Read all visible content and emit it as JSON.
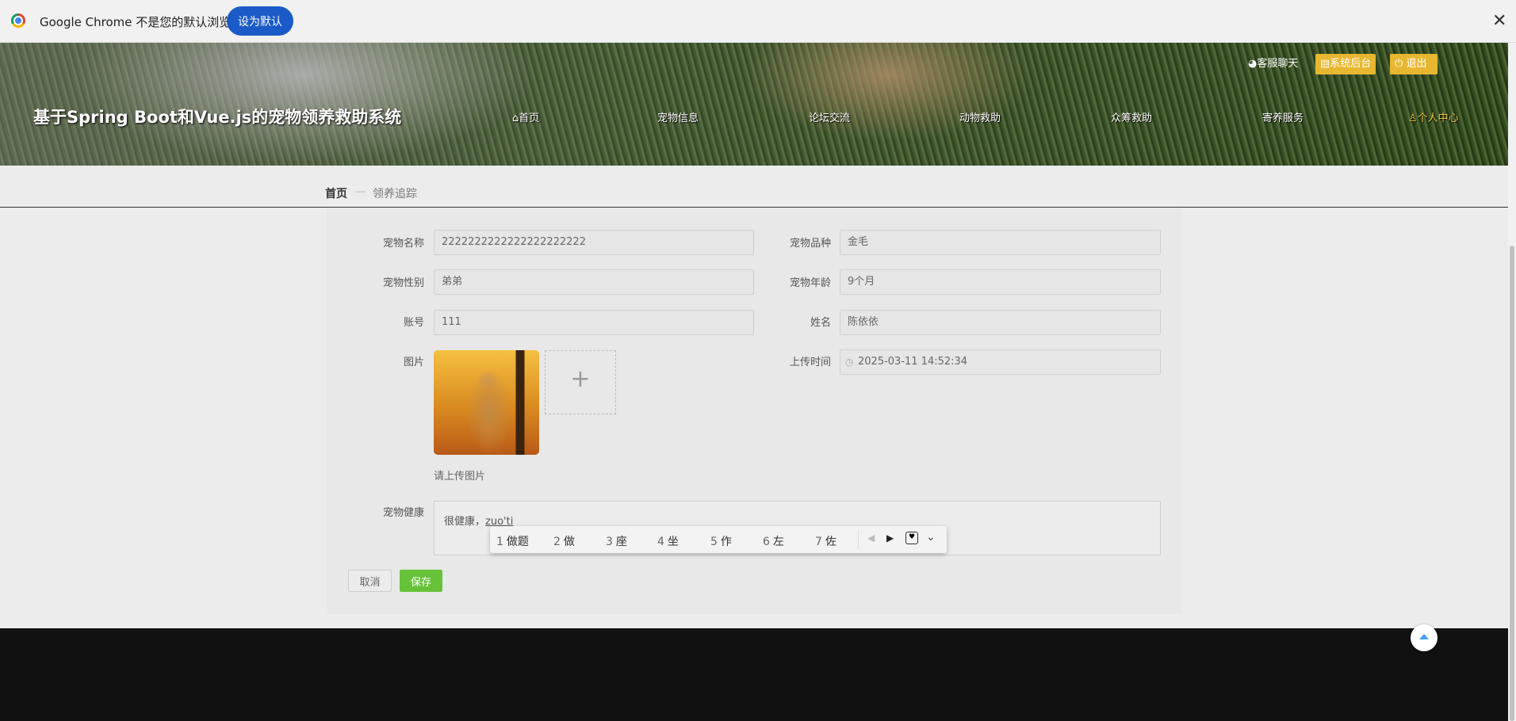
{
  "infobar": {
    "message": "Google Chrome 不是您的默认浏览器",
    "set_default_label": "设为默认",
    "close_glyph": "✕"
  },
  "header": {
    "site_title": "基于Spring Boot和Vue.js的宠物领养救助系统",
    "top_links": {
      "chat": "客服聊天",
      "admin": "系统后台",
      "logout": "退出"
    },
    "nav": [
      {
        "label": "首页",
        "icon": "home-icon"
      },
      {
        "label": "宠物信息"
      },
      {
        "label": "论坛交流"
      },
      {
        "label": "动物救助"
      },
      {
        "label": "众筹救助"
      },
      {
        "label": "寄养服务"
      },
      {
        "label": "个人中心",
        "icon": "user-icon",
        "active": true
      }
    ]
  },
  "breadcrumb": {
    "home": "首页",
    "separator": "—",
    "current": "领养追踪"
  },
  "form": {
    "pet_name": {
      "label": "宠物名称",
      "value": "2222222222222222222222"
    },
    "pet_breed": {
      "label": "宠物品种",
      "value": "金毛"
    },
    "pet_gender": {
      "label": "宠物性别",
      "value": "弟弟"
    },
    "pet_age": {
      "label": "宠物年龄",
      "value": "9个月"
    },
    "account": {
      "label": "账号",
      "value": "111"
    },
    "name": {
      "label": "姓名",
      "value": "陈依依"
    },
    "image": {
      "label": "图片",
      "hint": "请上传图片"
    },
    "upload_time": {
      "label": "上传时间",
      "value": "2025-03-11 14:52:34"
    },
    "health": {
      "label": "宠物健康",
      "value_prefix": "很健康，",
      "value_pinyin": "zuo'ti"
    },
    "cancel_label": "取消",
    "save_label": "保存"
  },
  "ime": {
    "candidates": [
      {
        "num": "1",
        "text": "做题"
      },
      {
        "num": "2",
        "text": "做"
      },
      {
        "num": "3",
        "text": "座"
      },
      {
        "num": "4",
        "text": "坐"
      },
      {
        "num": "5",
        "text": "作"
      },
      {
        "num": "6",
        "text": "左"
      },
      {
        "num": "7",
        "text": "佐"
      }
    ]
  },
  "colors": {
    "accent_blue": "#1a5bc7",
    "save_green": "#67c23a",
    "header_yellow": "#e8b731"
  }
}
